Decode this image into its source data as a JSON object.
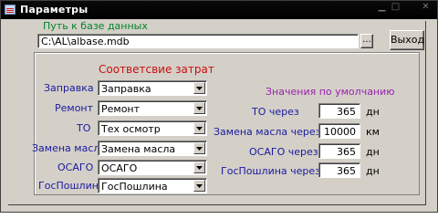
{
  "window": {
    "title": "Параметры"
  },
  "db": {
    "label": "Путь к базе данных",
    "path": "C:\\AL\\albase.mdb",
    "browse": "...",
    "exit": "Выход"
  },
  "costs": {
    "heading": "Соответсвие затрат",
    "rows": [
      {
        "label": "Заправка",
        "value": "Заправка"
      },
      {
        "label": "Ремонт",
        "value": "Ремонт"
      },
      {
        "label": "ТО",
        "value": "Тех осмотр"
      },
      {
        "label": "Замена масла",
        "value": "Замена масла"
      },
      {
        "label": "ОСАГО",
        "value": "ОСАГО"
      },
      {
        "label": "ГосПошлина",
        "value": "ГосПошлина"
      }
    ]
  },
  "defaults": {
    "heading": "Значения по умолчанию",
    "rows": [
      {
        "label": "ТО через",
        "value": "365",
        "unit": "дн"
      },
      {
        "label": "Замена масла через",
        "value": "10000",
        "unit": "км"
      },
      {
        "label": "ОСАГО через",
        "value": "365",
        "unit": "дн"
      },
      {
        "label": "ГосПошлина через",
        "value": "365",
        "unit": "дн"
      }
    ]
  }
}
